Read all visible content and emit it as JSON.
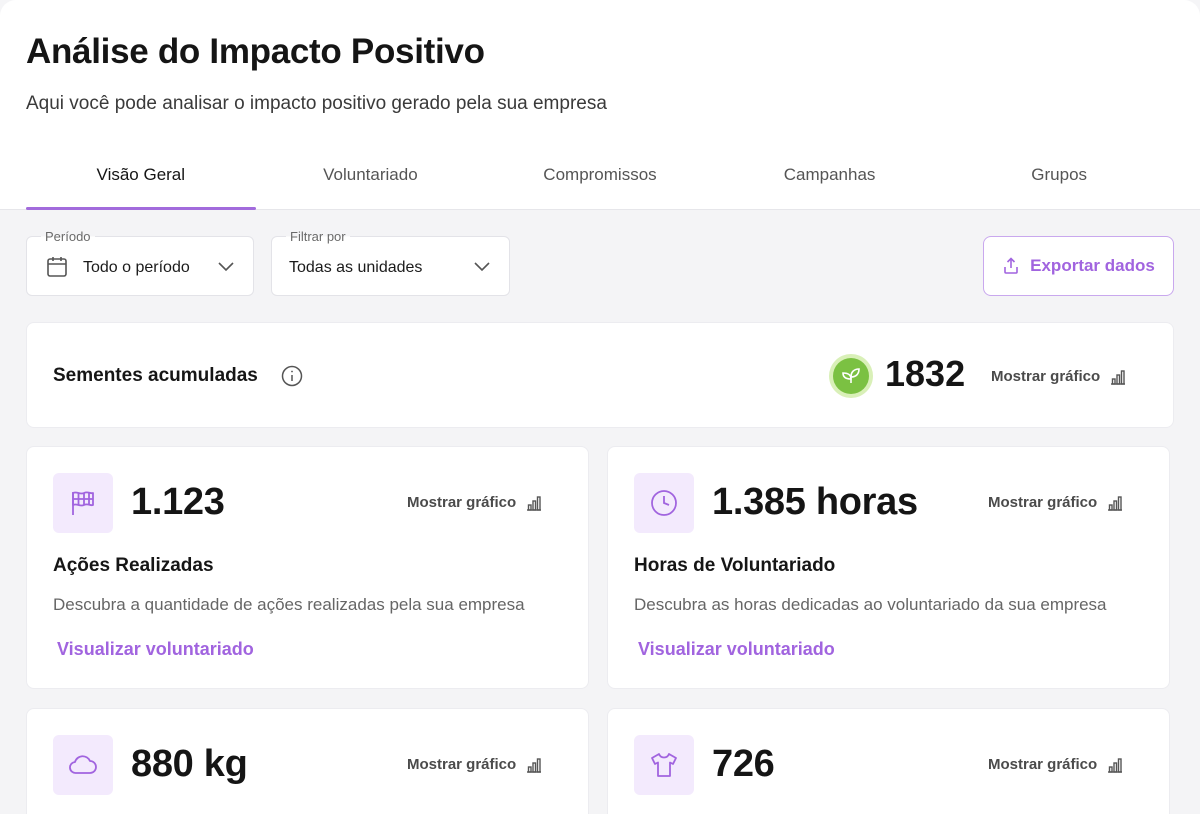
{
  "header": {
    "title": "Análise do Impacto Positivo",
    "subtitle": "Aqui você pode analisar o impacto positivo gerado pela sua empresa"
  },
  "tabs": [
    {
      "label": "Visão Geral",
      "active": true
    },
    {
      "label": "Voluntariado",
      "active": false
    },
    {
      "label": "Compromissos",
      "active": false
    },
    {
      "label": "Campanhas",
      "active": false
    },
    {
      "label": "Grupos",
      "active": false
    }
  ],
  "filters": {
    "period": {
      "label": "Período",
      "value": "Todo o período"
    },
    "filter_by": {
      "label": "Filtrar por",
      "value": "Todas as unidades"
    }
  },
  "export": {
    "label": "Exportar dados"
  },
  "seeds": {
    "title": "Sementes acumuladas",
    "value": "1832",
    "show_chart": "Mostrar gráfico"
  },
  "metrics": [
    {
      "icon": "flag-icon",
      "value": "1.123",
      "show_chart": "Mostrar gráfico",
      "title": "Ações Realizadas",
      "description": "Descubra a quantidade de ações realizadas pela sua empresa",
      "link": "Visualizar voluntariado"
    },
    {
      "icon": "clock-icon",
      "value": "1.385 horas",
      "show_chart": "Mostrar gráfico",
      "title": "Horas de Voluntariado",
      "description": "Descubra as horas dedicadas ao voluntariado da sua empresa",
      "link": "Visualizar voluntariado"
    },
    {
      "icon": "cloud-icon",
      "value": "880 kg",
      "show_chart": "Mostrar gráfico"
    },
    {
      "icon": "tshirt-icon",
      "value": "726",
      "show_chart": "Mostrar gráfico"
    }
  ],
  "colors": {
    "accent": "#a164df",
    "accent_light": "#f3eafd",
    "seed_green": "#7bc142"
  }
}
